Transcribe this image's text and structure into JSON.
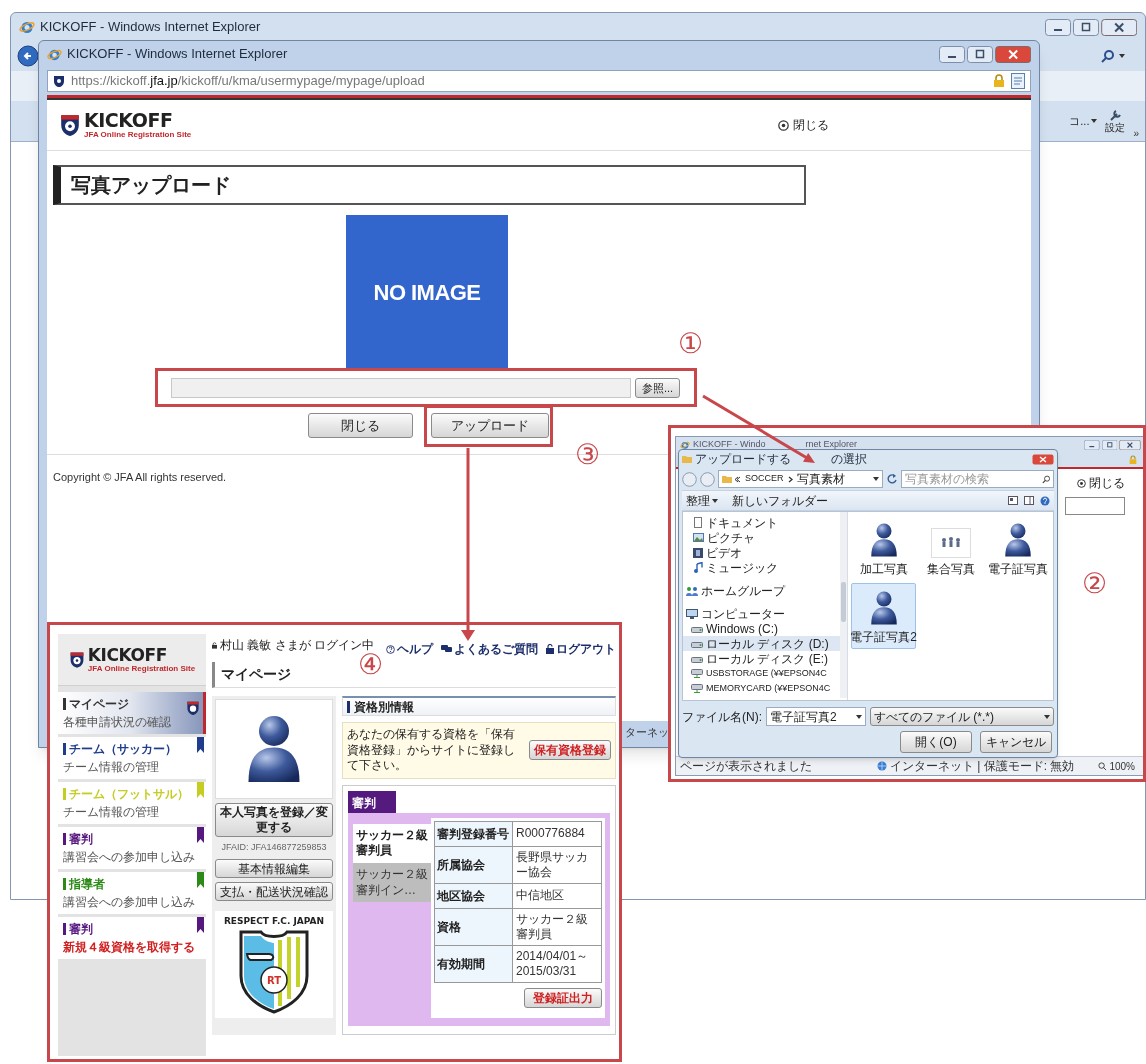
{
  "back_window": {
    "title": "KICKOFF - Windows Internet Explorer",
    "toolbar": [
      {
        "label": "コ...",
        "kind": "menu"
      },
      {
        "label": "設定",
        "kind": "tools"
      }
    ],
    "overflow_mark": "»"
  },
  "popup": {
    "title": "KICKOFF - Windows Internet Explorer",
    "url": "https://kickoff.**jfa.jp**/kickoff/u/kma/usermypage/mypage/upload",
    "status_text": "ターネッ",
    "page": {
      "logo": {
        "name": "KICKOFF",
        "tagline": "JFA Online Registration Site"
      },
      "close_link": "閉じる",
      "heading": "写真アップロード",
      "photo_label": "NO IMAGE",
      "browse_button": "参照...",
      "buttons": [
        "閉じる",
        "アップロード"
      ],
      "copyright": "Copyright © JFA All rights reserved."
    }
  },
  "callouts": [
    "①",
    "②",
    "③",
    "④"
  ],
  "file_dialog_screenshot": {
    "window_title_parts": [
      "KICKOFF - Windo",
      "rnet Explorer"
    ],
    "close_link": "閉じる",
    "status_text": "ページが表示されました",
    "zone_text": "インターネット | 保護モード: 無効",
    "zoom": "100%",
    "dialog": {
      "title_parts": [
        "アップロードする",
        "の選択"
      ],
      "path": [
        "SOCCER",
        "写真素材"
      ],
      "search": {
        "placeholder": "写真素材の検索"
      },
      "toolbar": [
        "整理",
        "新しいフォルダー"
      ],
      "nav": [
        {
          "label": "ドキュメント",
          "kind": "document",
          "selected": false
        },
        {
          "label": "ピクチャ",
          "kind": "pictures",
          "selected": false
        },
        {
          "label": "ビデオ",
          "kind": "video",
          "selected": false
        },
        {
          "label": "ミュージック",
          "kind": "music",
          "selected": false
        },
        {
          "label": "ホームグループ",
          "kind": "homegroup",
          "selected": false
        },
        {
          "label": "コンピューター",
          "kind": "computer",
          "selected": false,
          "children": [
            {
              "label": "Windows (C:)",
              "kind": "drive",
              "selected": false
            },
            {
              "label": "ローカル ディスク (D:)",
              "kind": "drive",
              "selected": true
            },
            {
              "label": "ローカル ディスク (E:)",
              "kind": "drive",
              "selected": false
            },
            {
              "label": "USBSTORAGE (¥¥EPSON4C",
              "kind": "network",
              "selected": false
            },
            {
              "label": "MEMORYCARD (¥¥EPSON4C",
              "kind": "network",
              "selected": false
            }
          ]
        }
      ],
      "files": [
        {
          "name": "加工写真",
          "kind": "person",
          "selected": false
        },
        {
          "name": "集合写真",
          "kind": "group",
          "selected": false
        },
        {
          "name": "電子証写真",
          "kind": "person",
          "selected": false
        },
        {
          "name": "電子証写真2",
          "kind": "person",
          "selected": true
        }
      ],
      "filename_label": "ファイル名(N):",
      "filename": "電子証写真2",
      "filter": "すべてのファイル (*.*)",
      "buttons": [
        "開く(O)",
        "キャンセル"
      ]
    }
  },
  "mypage_screenshot": {
    "logo": {
      "name": "KICKOFF",
      "tagline": "JFA Online Registration Site"
    },
    "login_status": "村山 義敏 さまが ログイン中",
    "links": [
      {
        "label": "ヘルプ",
        "kind": "help"
      },
      {
        "label": "よくあるご質問",
        "kind": "faq"
      },
      {
        "label": "ログアウト",
        "kind": "logout"
      }
    ],
    "heading": "マイページ",
    "menu": [
      {
        "title": "マイページ",
        "subtitle": "各種申請状況の確認",
        "color": "#333333",
        "selected": true,
        "kind": "normal"
      },
      {
        "title": "チーム（サッカー）",
        "subtitle": "チーム情報の管理",
        "color": "#1f3d8a",
        "selected": false,
        "kind": "normal"
      },
      {
        "title": "チーム（フットサル）",
        "subtitle": "チーム情報の管理",
        "color": "#c5cc22",
        "selected": false,
        "kind": "normal"
      },
      {
        "title": "審判",
        "subtitle": "講習会への参加申し込み",
        "color": "#56177f",
        "selected": false,
        "kind": "normal"
      },
      {
        "title": "指導者",
        "subtitle": "講習会への参加申し込み",
        "color": "#2e8a18",
        "selected": false,
        "kind": "normal"
      },
      {
        "title": "審判",
        "subtitle": "新規４級資格を取得する",
        "color": "#56177f",
        "selected": false,
        "kind": "alert"
      }
    ],
    "photo_button": "本人写真を登録／変更する",
    "jfaid": "JFAID: JFA146877259853",
    "profile_buttons": [
      "基本情報編集",
      "支払・配送状況確認"
    ],
    "crest": {
      "title": "RESPECT F.C. JAPAN",
      "mark": "RT"
    },
    "section_heading": "資格別情報",
    "notice": "あなたの保有する資格を「保有資格登録」からサイトに登録して下さい。",
    "notice_button": "保有資格登録",
    "tabs": [
      {
        "label": "審判",
        "selected": true
      }
    ],
    "qualifications": [
      {
        "label": "サッカー２級審判員",
        "selected": true
      },
      {
        "label": "サッカー２級審判イン…",
        "selected": false
      }
    ],
    "details": [
      {
        "label": "審判登録番号",
        "value": "R000776884"
      },
      {
        "label": "所属協会",
        "value": "長野県サッカー協会"
      },
      {
        "label": "地区協会",
        "value": "中信地区"
      },
      {
        "label": "資格",
        "value": "サッカー２級審判員"
      },
      {
        "label": "有効期間",
        "value": "2014/04/01～ 2015/03/31"
      }
    ],
    "print_button": "登録証出力"
  }
}
